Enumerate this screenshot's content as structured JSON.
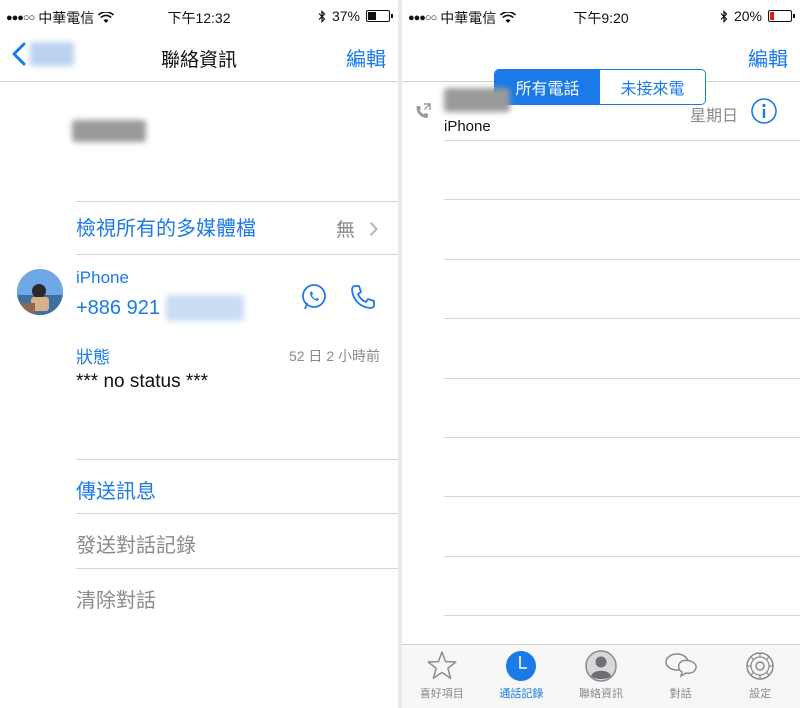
{
  "left": {
    "statusbar": {
      "carrier": "中華電信",
      "time": "下午12:32",
      "battery": "37%",
      "battery_level": 0.37
    },
    "nav": {
      "title": "聯絡資訊",
      "edit": "編輯"
    },
    "media": {
      "label": "檢視所有的多媒體檔",
      "value": "無"
    },
    "phone": {
      "label": "iPhone",
      "number_prefix": "+886 921"
    },
    "status": {
      "label": "狀態",
      "time": "52 日 2 小時前",
      "text": "*** no status ***"
    },
    "actions": {
      "send_message": "傳送訊息",
      "send_chat_history": "發送對話記錄",
      "clear_chat": "清除對話"
    }
  },
  "right": {
    "statusbar": {
      "carrier": "中華電信",
      "time": "下午9:20",
      "battery": "20%",
      "battery_level": 0.2
    },
    "segments": {
      "all": "所有電話",
      "missed": "未接來電"
    },
    "nav": {
      "edit": "編輯"
    },
    "call": {
      "type": "iPhone",
      "day": "星期日"
    },
    "tabs": [
      {
        "label": "喜好項目",
        "icon": "star-icon"
      },
      {
        "label": "通話記錄",
        "icon": "clock-icon"
      },
      {
        "label": "聯絡資訊",
        "icon": "contacts-icon"
      },
      {
        "label": "對話",
        "icon": "chats-icon"
      },
      {
        "label": "設定",
        "icon": "settings-icon"
      }
    ]
  },
  "colors": {
    "accent": "#1a7ae8",
    "secondary_text": "#8a8a8f",
    "battery_low": "#e0201a"
  }
}
